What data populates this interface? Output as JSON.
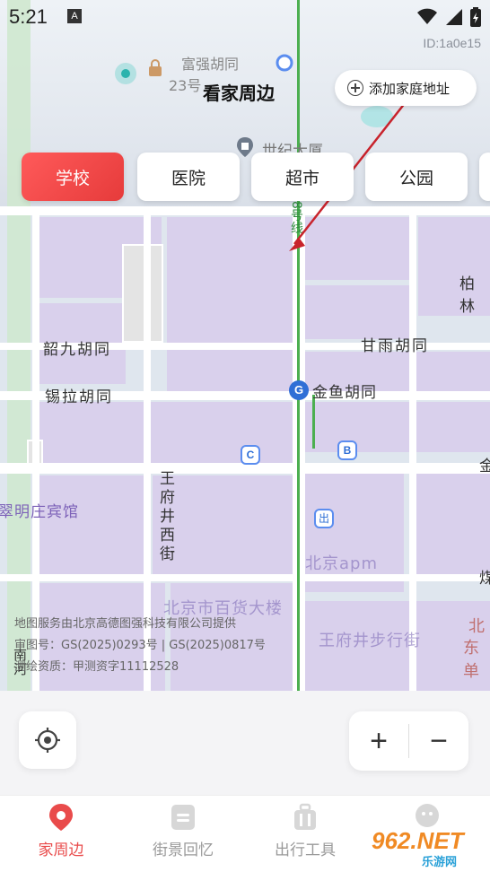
{
  "status_bar": {
    "time": "5:21",
    "notif_badge": "A"
  },
  "header": {
    "title": "看家周边",
    "map_id": "ID:1a0e15",
    "add_address_label": "添加家庭地址"
  },
  "categories": [
    {
      "label": "学校",
      "active": true
    },
    {
      "label": "医院",
      "active": false
    },
    {
      "label": "超市",
      "active": false
    },
    {
      "label": "公园",
      "active": false
    }
  ],
  "map_labels": {
    "fuqiang": "富强胡同",
    "no23": "23号",
    "shiji": "世纪大厦",
    "metro8": "8号线",
    "baike": "柏林",
    "shaojiu": "韶九胡同",
    "ganyu": "甘雨胡同",
    "xila": "锡拉胡同",
    "jinyu": "金鱼胡同",
    "wangfujing_west": "王府井西街",
    "cuiming": "翠明庄宾馆",
    "apm": "北京apm",
    "baihuo": "北京市百货大楼",
    "buxingjie": "王府井步行街",
    "nanhe": "南河",
    "bei": "北",
    "dongdan": "东单",
    "chu": "出",
    "station_b": "B",
    "station_c": "C",
    "jin": "金",
    "xi": "煤"
  },
  "credits": {
    "line1": "地图服务由北京高德图强科技有限公司提供",
    "line2": "审图号：GS(2025)0293号 | GS(2025)0817号",
    "line3": "测绘资质：甲测资字11112528"
  },
  "controls": {
    "zoom_in": "+",
    "zoom_out": "−"
  },
  "tabs": [
    {
      "label": "家周边",
      "icon": "map-pin-icon",
      "active": true
    },
    {
      "label": "街景回忆",
      "icon": "album-icon",
      "active": false
    },
    {
      "label": "出行工具",
      "icon": "suitcase-icon",
      "active": false
    },
    {
      "label": "",
      "icon": "profile-icon",
      "active": false
    }
  ],
  "watermark": {
    "text": "962.NET",
    "subtext": "乐游网"
  },
  "colors": {
    "accent": "#e94b4b",
    "metro": "#4caf50",
    "block": "#d9d0ec"
  }
}
